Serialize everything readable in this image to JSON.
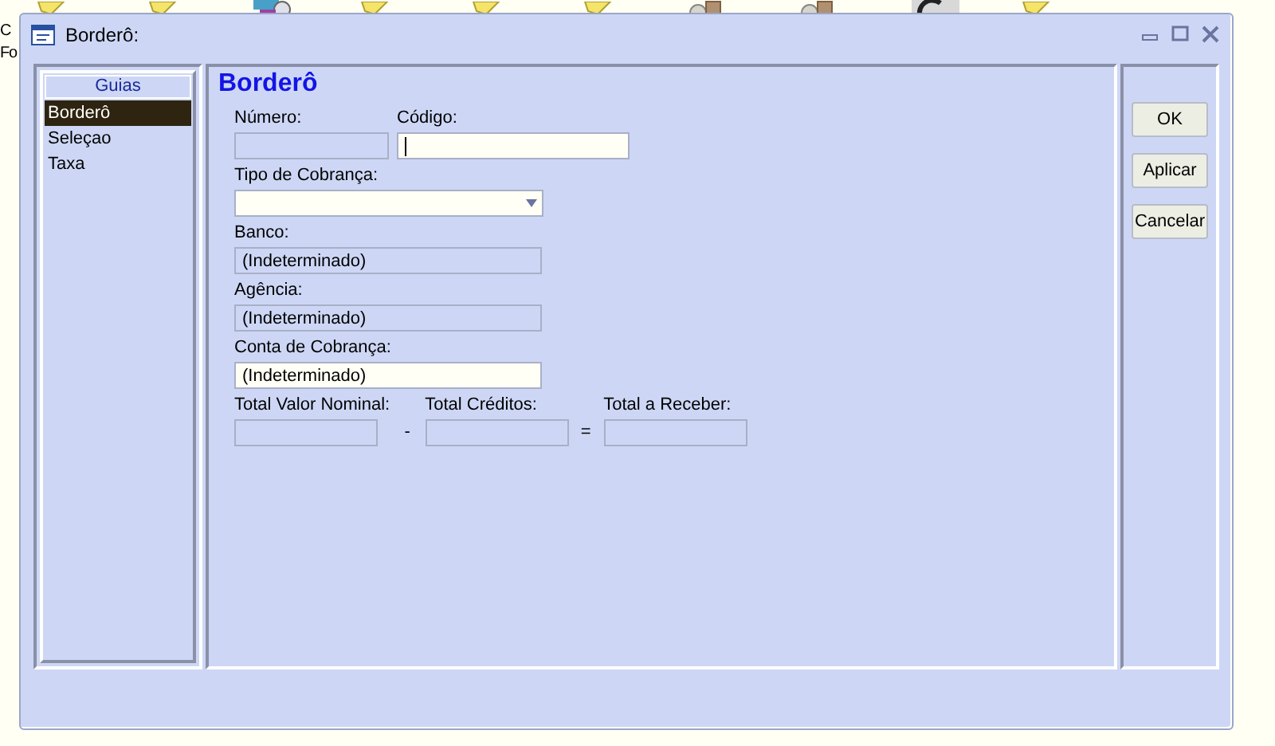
{
  "desktop": {
    "icons": [
      {
        "kind": "note"
      },
      {
        "kind": "note"
      },
      {
        "kind": "figure"
      },
      {
        "kind": "note"
      },
      {
        "kind": "note"
      },
      {
        "kind": "note"
      },
      {
        "kind": "gears"
      },
      {
        "kind": "gears"
      },
      {
        "kind": "dark"
      },
      {
        "kind": "note"
      }
    ],
    "texts": [
      "C",
      "Fo"
    ]
  },
  "window": {
    "title": "Borderô:"
  },
  "sidebar": {
    "title": "Guias",
    "items": [
      {
        "label": "Borderô",
        "selected": true
      },
      {
        "label": "Seleçao",
        "selected": false
      },
      {
        "label": "Taxa",
        "selected": false
      }
    ]
  },
  "form": {
    "title": "Borderô",
    "rows": [
      [
        {
          "kind": "text",
          "label": "Número:",
          "disabled": true
        },
        {
          "kind": "text",
          "label": "Código:",
          "disabled": false,
          "focused": true
        }
      ],
      [
        {
          "kind": "dropdown",
          "label": "Tipo de Cobrança:",
          "disabled": false
        }
      ],
      [
        {
          "kind": "text",
          "label": "Banco:",
          "value": "(Indeterminado)",
          "disabled": true
        }
      ],
      [
        {
          "kind": "text",
          "label": "Agência:",
          "value": "(Indeterminado)",
          "disabled": true
        }
      ],
      [
        {
          "kind": "text",
          "label": "Conta de Cobrança:",
          "value": "(Indeterminado)",
          "disabled": false
        }
      ],
      [
        {
          "kind": "text",
          "label": "Total Valor Nominal:",
          "disabled": true
        },
        {
          "kind": "text",
          "label": "Total Créditos:",
          "disabled": true,
          "operator": "-"
        },
        {
          "kind": "text",
          "label": "Total a Receber:",
          "disabled": true,
          "operator": "="
        }
      ]
    ]
  },
  "buttons": [
    "OK",
    "Aplicar",
    "Cancelar"
  ]
}
